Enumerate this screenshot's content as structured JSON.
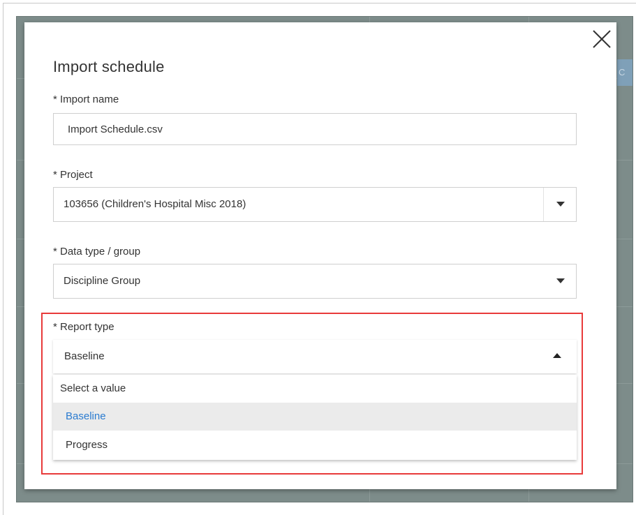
{
  "dialog": {
    "title": "Import schedule",
    "close_icon": "close-icon"
  },
  "fields": {
    "import_name": {
      "label": "* Import name",
      "value": "Import Schedule.csv"
    },
    "project": {
      "label": "* Project",
      "value": "103656 (Children's Hospital Misc 2018)",
      "icon": "chevron-down-icon"
    },
    "data_type": {
      "label": "* Data type / group",
      "value": "Discipline Group",
      "icon": "chevron-down-icon"
    },
    "report_type": {
      "label": "* Report type",
      "value": "Baseline",
      "icon": "chevron-up-icon",
      "options": [
        "Select a value",
        "Baseline",
        "Progress"
      ],
      "selected_option": "Baseline"
    }
  },
  "colors": {
    "highlight": "#e83a3a",
    "selected_text": "#2a7bd0",
    "selected_bg": "#ebebeb",
    "backdrop": "#7d8c8a"
  }
}
